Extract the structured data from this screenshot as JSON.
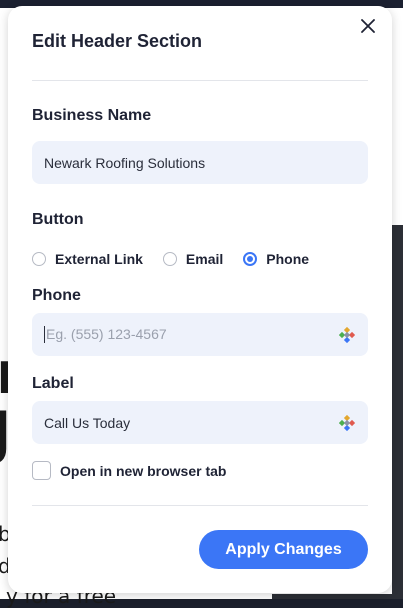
{
  "background": {
    "big_letter_1": "r",
    "big_letter_2": "J",
    "small_1": "b",
    "small_2": "d",
    "bottom_text": "y for a free"
  },
  "modal": {
    "title": "Edit Header Section",
    "close_icon": "close-icon"
  },
  "business_name": {
    "label": "Business Name",
    "value": "Newark Roofing Solutions"
  },
  "button": {
    "label": "Button",
    "options": [
      {
        "label": "External Link",
        "selected": false
      },
      {
        "label": "Email",
        "selected": false
      },
      {
        "label": "Phone",
        "selected": true
      }
    ]
  },
  "phone": {
    "label": "Phone",
    "placeholder": "Eg. (555) 123-4567",
    "value": ""
  },
  "label_field": {
    "label": "Label",
    "value": "Call Us Today"
  },
  "open_new_tab": {
    "label": "Open in new browser tab",
    "checked": false
  },
  "apply_button": {
    "label": "Apply Changes"
  },
  "colors": {
    "accent": "#3b76f6",
    "input_bg": "#eef2fb",
    "text": "#1f2335"
  }
}
